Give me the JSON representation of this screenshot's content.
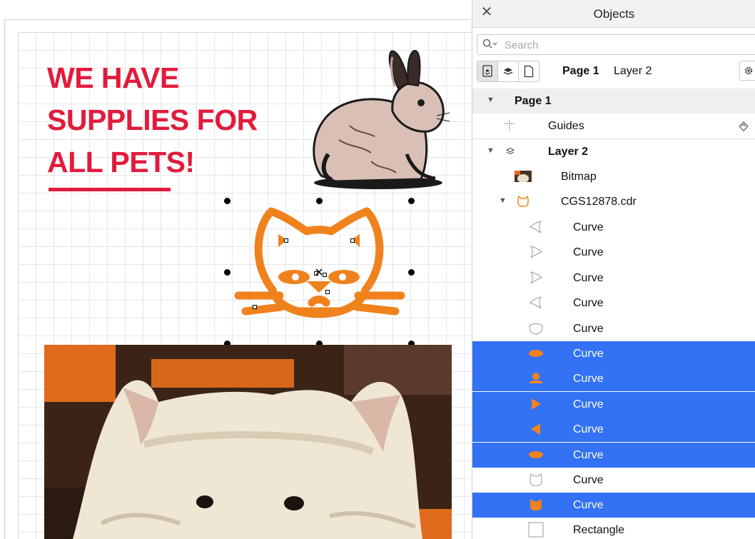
{
  "canvas": {
    "headline_lines": [
      "WE HAVE",
      "SUPPLIES FOR",
      "ALL PETS!"
    ],
    "accent_color": "#e21b3c",
    "cat_color": "#f0821e"
  },
  "panel": {
    "title": "Objects",
    "search_placeholder": "Search",
    "toolbar": {
      "page_label": "Page 1",
      "layer_label": "Layer 2"
    },
    "tree": {
      "page": "Page 1",
      "guides": "Guides",
      "layer": "Layer 2",
      "bitmap": "Bitmap",
      "group": "CGS12878.cdr",
      "curves": [
        "Curve",
        "Curve",
        "Curve",
        "Curve",
        "Curve",
        "Curve",
        "Curve",
        "Curve",
        "Curve",
        "Curve",
        "Curve",
        "Curve"
      ],
      "rectangle": "Rectangle"
    },
    "selection_color": "#3371f5"
  }
}
